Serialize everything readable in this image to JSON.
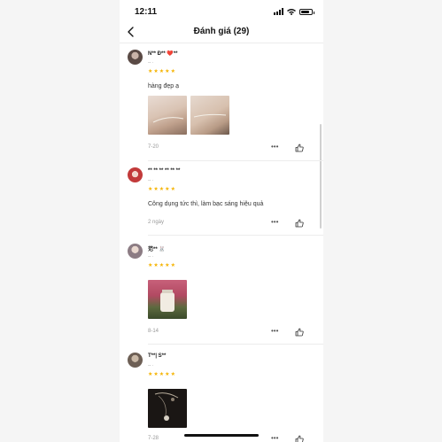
{
  "status": {
    "time": "12:11",
    "battery_level": 0.85
  },
  "nav": {
    "title": "Đánh giá (29)"
  },
  "reviews": [
    {
      "user": "N** Đ** ❤️**",
      "variant": "-- ·",
      "rating": 5,
      "comment": "hàng đẹp ạ",
      "date": "7-20"
    },
    {
      "user": "** ** ** ** ** **",
      "variant": "-- ·",
      "rating": 5,
      "comment": "Công dụng tức thì, làm bạc sáng hiệu quả",
      "date": "2 ngày"
    },
    {
      "user": "范** 🐰",
      "variant": "-- ·",
      "rating": 5,
      "comment": "",
      "date": "8-14"
    },
    {
      "user": "T**| S**",
      "variant": "-- ·",
      "rating": 5,
      "comment": "",
      "date": "7-28"
    }
  ],
  "actions": {
    "more": "•••"
  },
  "colors": {
    "star": "#f5b301",
    "separator": "#ececec",
    "muted": "#999999"
  }
}
